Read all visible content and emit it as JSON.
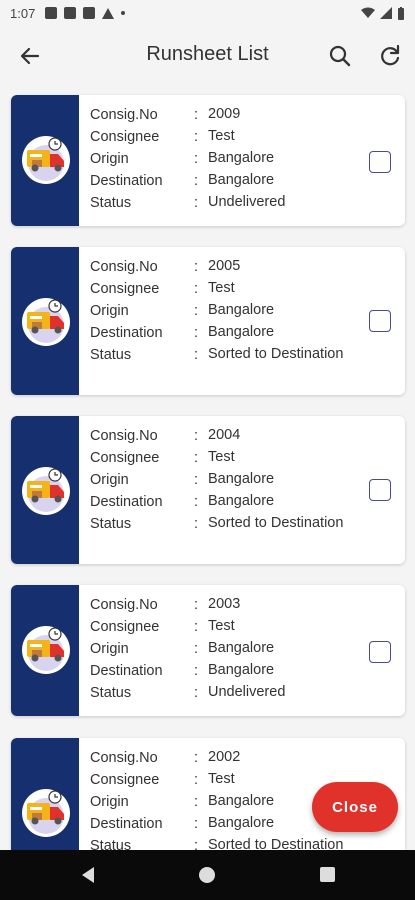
{
  "status_bar": {
    "time": "1:07"
  },
  "app_bar": {
    "title": "Runsheet List"
  },
  "field_labels": {
    "consig_no": "Consig.No",
    "consignee": "Consignee",
    "origin": "Origin",
    "destination": "Destination",
    "status": "Status",
    "separator": ":"
  },
  "cards": [
    {
      "consig_no": "2009",
      "consignee": "Test",
      "origin": "Bangalore",
      "destination": "Bangalore",
      "status": "Undelivered",
      "checked": false
    },
    {
      "consig_no": "2005",
      "consignee": "Test",
      "origin": "Bangalore",
      "destination": "Bangalore",
      "status": "Sorted to Destination",
      "checked": false
    },
    {
      "consig_no": "2004",
      "consignee": "Test",
      "origin": "Bangalore",
      "destination": "Bangalore",
      "status": "Sorted to Destination",
      "checked": false
    },
    {
      "consig_no": "2003",
      "consignee": "Test",
      "origin": "Bangalore",
      "destination": "Bangalore",
      "status": "Undelivered",
      "checked": false
    },
    {
      "consig_no": "2002",
      "consignee": "Test",
      "origin": "Bangalore",
      "destination": "Bangalore",
      "status": "Sorted to Destination",
      "checked": false
    }
  ],
  "close_button": {
    "label": "Close"
  },
  "colors": {
    "card_band": "#162f6e",
    "close_button": "#e0322a",
    "checkbox_border": "#4a4a9a"
  },
  "icons": {
    "back": "arrow-left-icon",
    "search": "search-icon",
    "refresh": "refresh-icon",
    "card_logo": "delivery-truck-icon"
  }
}
